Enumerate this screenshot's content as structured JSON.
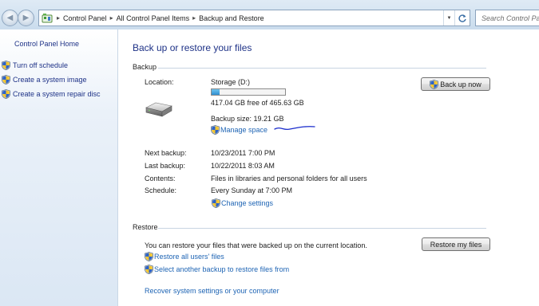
{
  "address_bar": {
    "breadcrumbs": [
      "Control Panel",
      "All Control Panel Items",
      "Backup and Restore"
    ],
    "search_placeholder": "Search Control Panel"
  },
  "sidebar": {
    "home": "Control Panel Home",
    "links": [
      "Turn off schedule",
      "Create a system image",
      "Create a system repair disc"
    ]
  },
  "main": {
    "title": "Back up or restore your files",
    "backup": {
      "heading": "Backup",
      "location_label": "Location:",
      "location_value": "Storage (D:)",
      "disk_used_fraction": 0.104,
      "free_space": "417.04 GB free of 465.63 GB",
      "backup_size": "Backup size: 19.21 GB",
      "manage_space": "Manage space",
      "back_up_now": "Back up now",
      "next_backup_label": "Next backup:",
      "next_backup_value": "10/23/2011 7:00 PM",
      "last_backup_label": "Last backup:",
      "last_backup_value": "10/22/2011 8:03 AM",
      "contents_label": "Contents:",
      "contents_value": "Files in libraries and personal folders for all users",
      "schedule_label": "Schedule:",
      "schedule_value": "Every Sunday at 7:00 PM",
      "change_settings": "Change settings"
    },
    "restore": {
      "heading": "Restore",
      "description": "You can restore your files that were backed up on the current location.",
      "restore_my_files": "Restore my files",
      "restore_all_users": "Restore all users' files",
      "select_another": "Select another backup to restore files from",
      "recover_system": "Recover system settings or your computer"
    }
  },
  "icons": {
    "shield": "uac-shield-icon",
    "drive": "hard-drive-icon",
    "control_panel": "control-panel-icon"
  },
  "colors": {
    "link": "#1e64b4",
    "heading": "#1e3287",
    "progress": "#2f8fd1",
    "annotation": "#1a2ccc"
  }
}
